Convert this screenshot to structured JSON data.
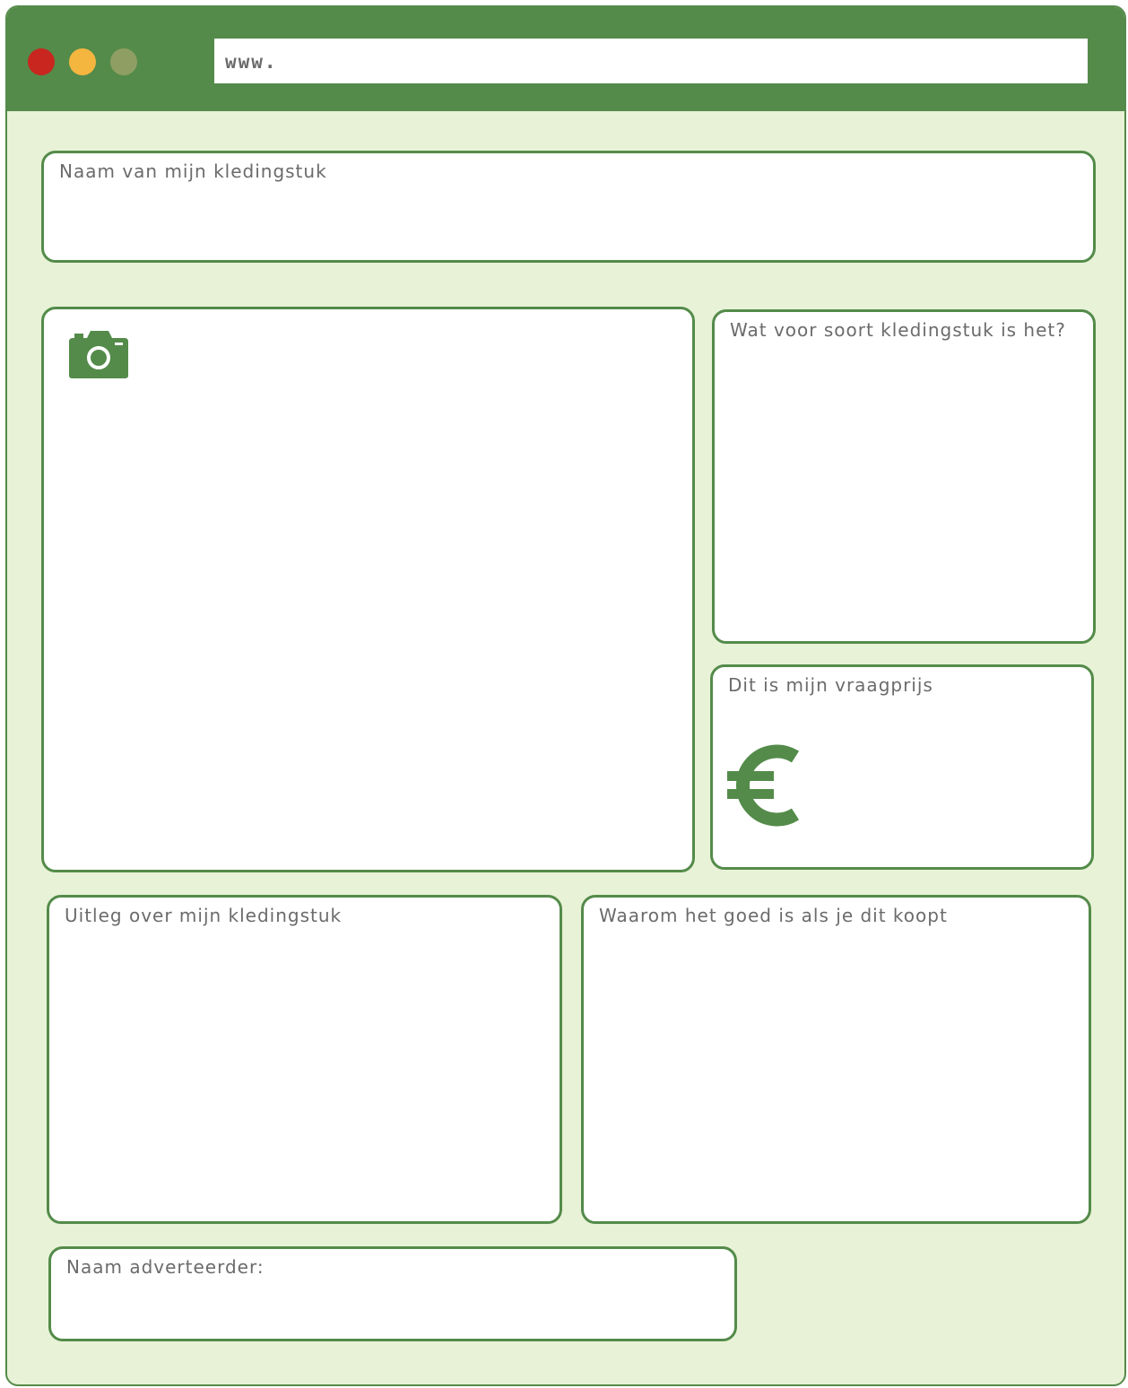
{
  "browser": {
    "url": "www.",
    "buttons": [
      "close",
      "minimize",
      "maximize"
    ]
  },
  "fields": {
    "name": {
      "label": "Naam van mijn kledingstuk",
      "value": ""
    },
    "photo": {
      "icon": "camera-icon"
    },
    "type": {
      "label": "Wat voor soort kledingstuk is het?",
      "value": ""
    },
    "price": {
      "label": "Dit is mijn vraagprijs",
      "icon": "euro-icon",
      "value": ""
    },
    "explanation": {
      "label": "Uitleg over mijn kledingstuk",
      "value": ""
    },
    "why_buy": {
      "label": "Waarom het goed is als je dit koopt",
      "value": ""
    },
    "advertiser": {
      "label": "Naam adverteerder:",
      "value": ""
    }
  },
  "colors": {
    "accent": "#548b4a",
    "background": "#e8f2d6",
    "close": "#c8261f",
    "minimize": "#f4b63f",
    "maximize": "#8f9f63",
    "text": "#6b6b6b"
  }
}
